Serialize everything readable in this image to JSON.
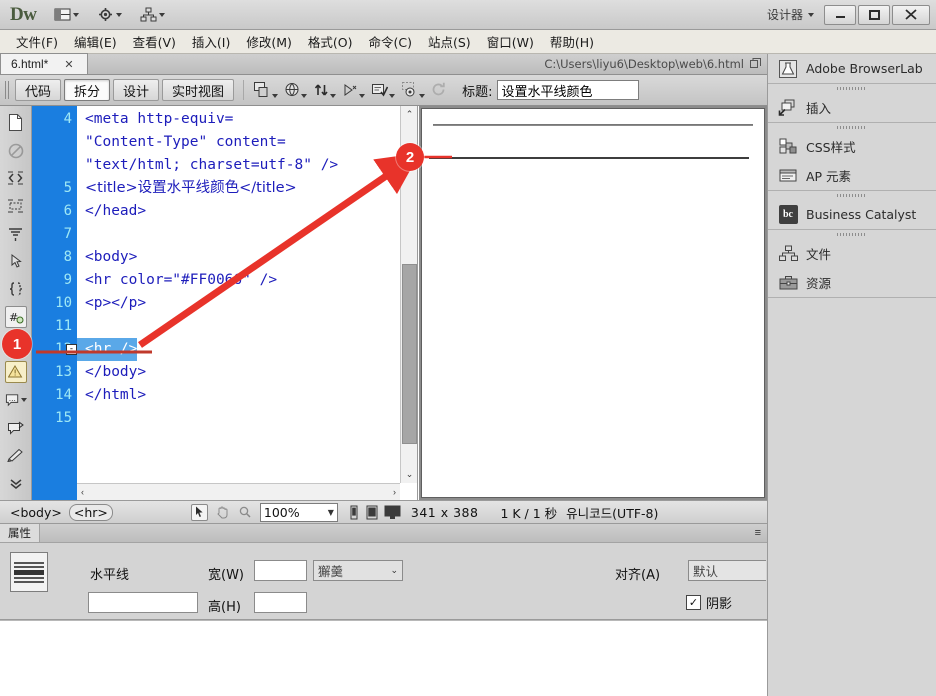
{
  "titlebar": {
    "app_logo": "Dw",
    "workspace_label": "设计器",
    "icons": [
      "layout-switch-icon",
      "gear-icon",
      "site-map-icon"
    ],
    "window_controls": {
      "minimize": "—",
      "maximize": "❐",
      "close": "✕"
    }
  },
  "menubar": {
    "items": [
      "文件(F)",
      "编辑(E)",
      "查看(V)",
      "插入(I)",
      "修改(M)",
      "格式(O)",
      "命令(C)",
      "站点(S)",
      "窗口(W)",
      "帮助(H)"
    ]
  },
  "doctab": {
    "filename": "6.html*",
    "close_label": "✕",
    "filepath": "C:\\Users\\liyu6\\Desktop\\web\\6.html"
  },
  "viewbar": {
    "buttons": [
      {
        "label": "代码",
        "active": false
      },
      {
        "label": "拆分",
        "active": true
      },
      {
        "label": "设计",
        "active": false
      },
      {
        "label": "实时视图",
        "active": false
      }
    ],
    "icons": [
      "live-code-icon",
      "preview-browser-icon",
      "file-management-icon",
      "visual-aids-icon",
      "validate-markup-icon",
      "check-browser-icon",
      "refresh-icon"
    ],
    "title_label": "标题:",
    "title_value": "设置水平线颜色"
  },
  "left_toolbar": {
    "icons": [
      "new-document-icon",
      "no-symbol-icon",
      "collapse-selection-icon",
      "expand-selection-icon",
      "collapse-full-tag-icon",
      "select-parent-tag-icon",
      "balance-braces-icon",
      "line-numbers-icon",
      "highlight-invalid-icon",
      "apply-comment-icon",
      "remove-comment-icon",
      "wrap-tag-icon",
      "recent-snippets-icon",
      "move-to-css-icon",
      "more-icon"
    ]
  },
  "code": {
    "lines": [
      {
        "num": "4",
        "text": "<meta http-equiv=",
        "cont": false,
        "selected": false
      },
      {
        "num": "",
        "text": "\"Content-Type\" content=",
        "cont": true,
        "selected": false
      },
      {
        "num": "",
        "text": "\"text/html; charset=utf-8\" />",
        "cont": true,
        "selected": false
      },
      {
        "num": "5",
        "text": "<title>设置水平线颜色</title>",
        "cont": false,
        "selected": false
      },
      {
        "num": "6",
        "text": "</head>",
        "cont": false,
        "selected": false
      },
      {
        "num": "7",
        "text": "",
        "cont": false,
        "selected": false
      },
      {
        "num": "8",
        "text": "<body>",
        "cont": false,
        "selected": false
      },
      {
        "num": "9",
        "text": "<hr color=\"#FF0066\" />",
        "cont": false,
        "selected": false
      },
      {
        "num": "10",
        "text": "<p></p>",
        "cont": false,
        "selected": false
      },
      {
        "num": "11",
        "text": "",
        "cont": false,
        "selected": false
      },
      {
        "num": "12",
        "text": "<hr />",
        "cont": false,
        "selected": true,
        "fold": "-"
      },
      {
        "num": "13",
        "text": "</body>",
        "cont": false,
        "selected": false
      },
      {
        "num": "14",
        "text": "</html>",
        "cont": false,
        "selected": false
      },
      {
        "num": "15",
        "text": "",
        "cont": false,
        "selected": false
      }
    ],
    "hscroll_left": "‹",
    "hscroll_right": "›",
    "vscroll_up": "⌃",
    "vscroll_down": "⌄"
  },
  "statusbar": {
    "tag_selector": [
      "<body>",
      "<hr>"
    ],
    "tools": [
      "select-arrow-icon",
      "hand-icon",
      "zoom-icon"
    ],
    "zoom": "100%",
    "screen_sizes": [
      "mobile-size-icon",
      "tablet-size-icon",
      "desktop-size-icon"
    ],
    "dimensions": "341 x 388",
    "weight": "1 K / 1 秒",
    "encoding": "유니코드(UTF-8)"
  },
  "properties": {
    "tab_label": "属性",
    "panel_menu": "≡",
    "element_icon": "horizontal-rule-icon",
    "element_name": "水平线",
    "id_value": "",
    "width_label": "宽(W)",
    "width_value": "",
    "unit_value": "獬羹",
    "height_label": "高(H)",
    "height_value": "",
    "align_label": "对齐(A)",
    "align_value": "默认",
    "shading_label": "阴影",
    "shading_checked": "✓"
  },
  "right_dock": {
    "groups": [
      {
        "has_handle": false,
        "items": [
          {
            "icon": "browserlab-icon",
            "label": "Adobe BrowserLab"
          }
        ]
      },
      {
        "has_handle": true,
        "items": [
          {
            "icon": "insert-icon",
            "label": "插入"
          }
        ]
      },
      {
        "has_handle": true,
        "items": [
          {
            "icon": "css-styles-icon",
            "label": "CSS样式"
          },
          {
            "icon": "ap-elements-icon",
            "label": "AP 元素"
          }
        ]
      },
      {
        "has_handle": true,
        "items": [
          {
            "icon": "business-catalyst-icon",
            "label": "Business Catalyst",
            "badge": "bc"
          }
        ]
      },
      {
        "has_handle": true,
        "items": [
          {
            "icon": "files-icon",
            "label": "文件"
          },
          {
            "icon": "assets-icon",
            "label": "资源"
          }
        ]
      }
    ]
  },
  "annotations": {
    "markers": [
      {
        "number": "1"
      },
      {
        "number": "2"
      }
    ],
    "accent_color": "#e8332a"
  }
}
